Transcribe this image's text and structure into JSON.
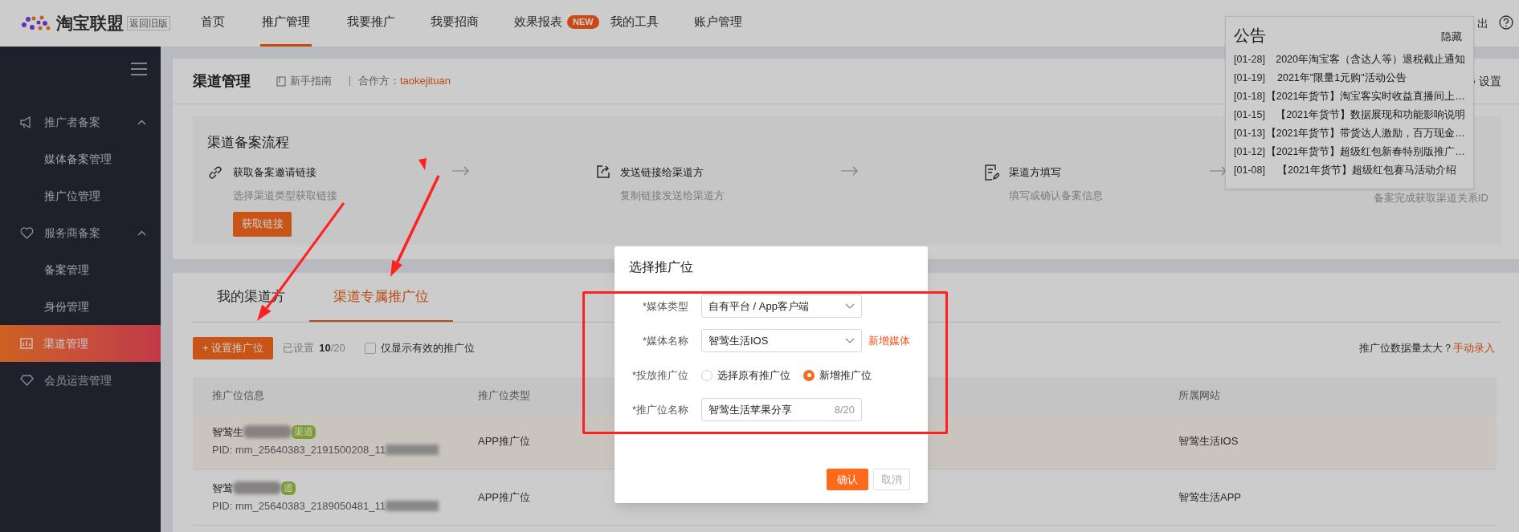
{
  "top_nav": {
    "logo_text": "淘宝联盟",
    "old_version": "返回旧版",
    "items": [
      {
        "label": "首页",
        "selected": false
      },
      {
        "label": "推广管理",
        "selected": true
      },
      {
        "label": "我要推广",
        "selected": false
      },
      {
        "label": "我要招商",
        "selected": false
      },
      {
        "label": "效果报表",
        "selected": false,
        "badge": "NEW"
      },
      {
        "label": "我的工具",
        "selected": false
      },
      {
        "label": "账户管理",
        "selected": false
      }
    ],
    "logout_fragment": "出"
  },
  "sidebar": {
    "items": [
      {
        "kind": "group",
        "label": "推广者备案",
        "expanded": true,
        "children": [
          {
            "label": "媒体备案管理",
            "selected": false
          },
          {
            "label": "推广位管理",
            "selected": false
          }
        ]
      },
      {
        "kind": "group",
        "label": "服务商备案",
        "expanded": true,
        "children": [
          {
            "label": "备案管理",
            "selected": false
          },
          {
            "label": "身份管理",
            "selected": false
          }
        ]
      },
      {
        "kind": "link",
        "label": "渠道管理",
        "selected": true
      },
      {
        "kind": "link",
        "label": "会员运营管理",
        "selected": false
      }
    ]
  },
  "page_header": {
    "title": "渠道管理",
    "guide": "新手指南",
    "partner_label": "合作方：",
    "partner": "taokejituan",
    "settings": "设置"
  },
  "process": {
    "title": "渠道备案流程",
    "steps": [
      {
        "title": "获取备案邀请链接",
        "description": "选择渠道类型获取链接",
        "button": "获取链接"
      },
      {
        "title": "发送链接给渠道方",
        "description": "复制链接发送给渠道方"
      },
      {
        "title": "渠道方填写",
        "description": "填写或确认备案信息"
      },
      {
        "description": "备案完成获取渠道关系ID"
      }
    ]
  },
  "tabs": [
    {
      "label": "我的渠道方",
      "selected": false
    },
    {
      "label": "渠道专属推广位",
      "selected": true
    }
  ],
  "toolbar": {
    "add_button": "+ 设置推广位",
    "count_label": "已设置",
    "count": "**10**/20",
    "filter": {
      "label": "仅显示有效的推广位",
      "checked": false
    },
    "hint": "推广位数据量太大？",
    "hint_link": "手动录入"
  },
  "table": {
    "columns": [
      "推广位信息",
      "推广位类型",
      "所属网站"
    ],
    "rows": [
      {
        "name": "智莺生",
        "badge": "渠道",
        "pid": "PID: mm_25640383_2191500208_11",
        "type": "APP推广位",
        "site": "智莺生活IOS",
        "highlighted": true
      },
      {
        "name": "智莺",
        "badge": "道",
        "pid": "PID: mm_25640383_2189050481_11",
        "type": "APP推广位",
        "site": "智莺生活APP",
        "highlighted": false
      }
    ]
  },
  "notice": {
    "title": "公告",
    "hide": "隐藏",
    "items": [
      {
        "date": "[01-28]",
        "text": "2020年淘宝客（含达人等）退税截止通知"
      },
      {
        "date": "[01-19]",
        "text": "2021年\"限量1元购\"活动公告"
      },
      {
        "date": "[01-18]",
        "text": "【2021年货节】淘宝客实时收益直播间上…"
      },
      {
        "date": "[01-15]",
        "text": "【2021年货节】数据展现和功能影响说明"
      },
      {
        "date": "[01-13]",
        "text": "【2021年货节】带货达人激励，百万现金…"
      },
      {
        "date": "[01-12]",
        "text": "【2021年货节】超级红包新春特别版推广…"
      },
      {
        "date": "[01-08]",
        "text": "【2021年货节】超级红包赛马活动介绍"
      }
    ]
  },
  "modal": {
    "title": "选择推广位",
    "fields": [
      {
        "kind": "select",
        "label": "*媒体类型",
        "value": "自有平台 / App客户端"
      },
      {
        "kind": "select",
        "label": "*媒体名称",
        "value": "智莺生活IOS",
        "link": "新增媒体"
      },
      {
        "kind": "radio",
        "label": "*投放推广位",
        "options": [
          {
            "label": "选择原有推广位",
            "selected": false
          },
          {
            "label": "新增推广位",
            "selected": true
          }
        ]
      },
      {
        "kind": "input",
        "label": "*推广位名称",
        "value": "智莺生活苹果分享",
        "counter": "8/20"
      }
    ],
    "buttons": [
      {
        "label": "确认",
        "kind": "primary"
      },
      {
        "label": "取消",
        "kind": "disabled"
      }
    ]
  }
}
